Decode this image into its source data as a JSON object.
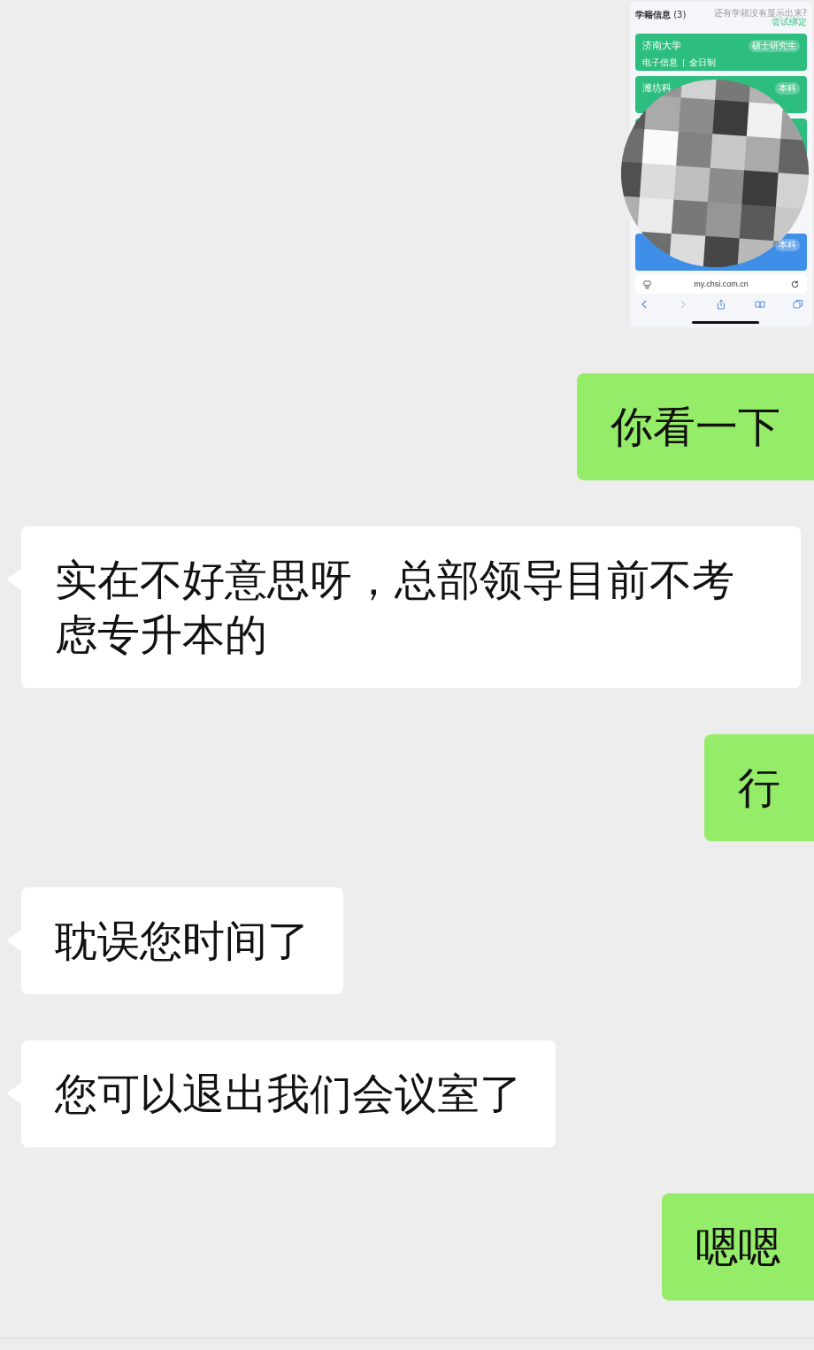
{
  "messages": [
    {
      "kind": "sent_image",
      "screenshot": {
        "title": "学籍信息",
        "count": "(3)",
        "hint": "还有学籍没有显示出来?",
        "link": "尝试绑定",
        "url": "my.chsi.com.cn",
        "cards": [
          {
            "color": "#2dbd7e",
            "name": "济南大学",
            "degree": "硕士研究生",
            "details": [
              "电子信息",
              "全日制"
            ]
          },
          {
            "color": "#2dbd7e",
            "name": "潍坊科",
            "degree": "本科"
          },
          {
            "color": "#2dbd7e"
          },
          {
            "color": "#3f8fe8",
            "degree": "本科"
          }
        ]
      }
    },
    {
      "kind": "sent_text",
      "text": "你看一下"
    },
    {
      "kind": "received_text",
      "text": "实在不好意思呀，总部领导目前不考虑专升本的"
    },
    {
      "kind": "sent_text",
      "text": "行"
    },
    {
      "kind": "received_text",
      "text": "耽误您时间了"
    },
    {
      "kind": "received_text",
      "text": "您可以退出我们会议室了"
    },
    {
      "kind": "sent_text",
      "text": "嗯嗯"
    }
  ]
}
